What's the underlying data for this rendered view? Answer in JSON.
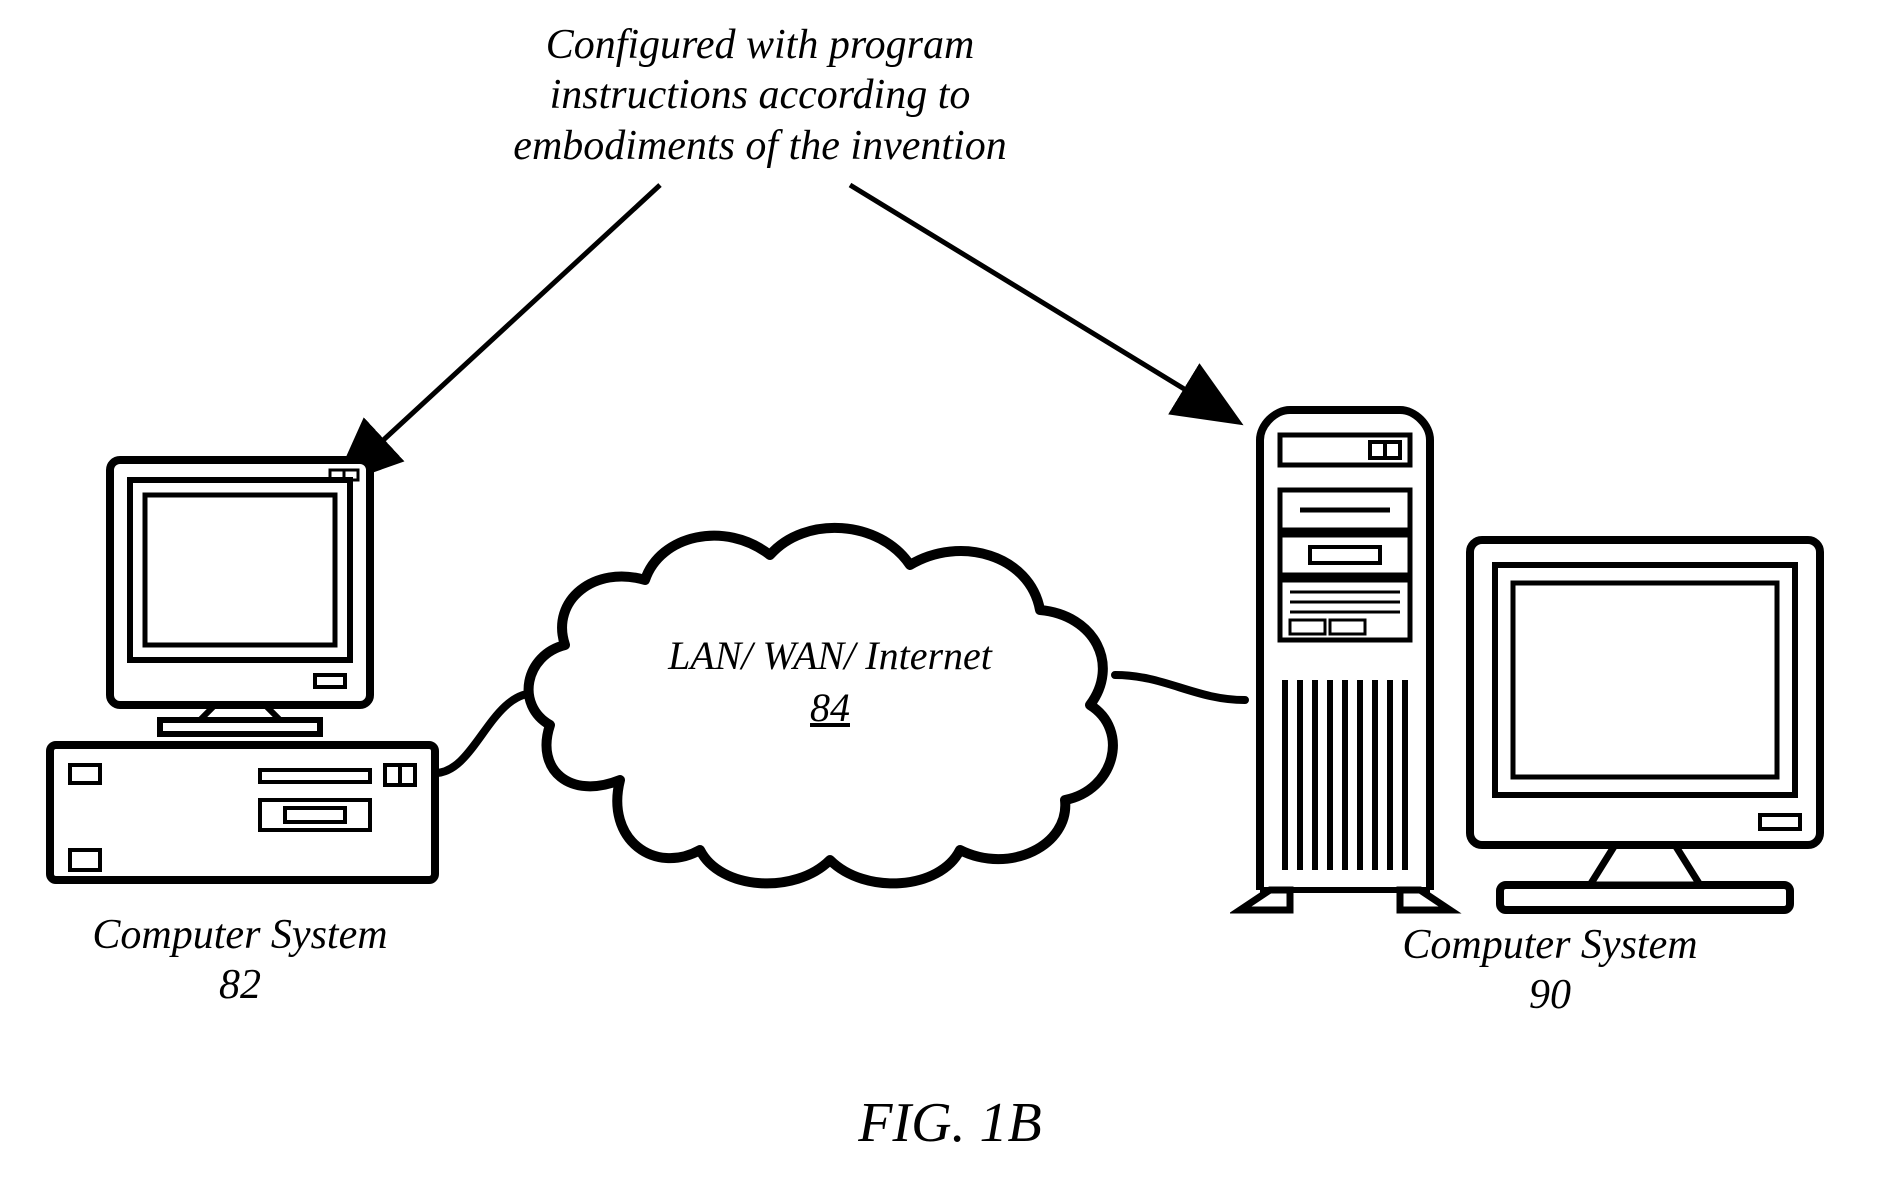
{
  "annotation": {
    "line1": "Configured with program",
    "line2": "instructions according to",
    "line3": "embodiments of the invention"
  },
  "cloud": {
    "title": "LAN/ WAN/ Internet",
    "ref": "84"
  },
  "leftComputer": {
    "title": "Computer System",
    "ref": "82"
  },
  "rightComputer": {
    "title": "Computer System",
    "ref": "90"
  },
  "figure": "FIG. 1B"
}
